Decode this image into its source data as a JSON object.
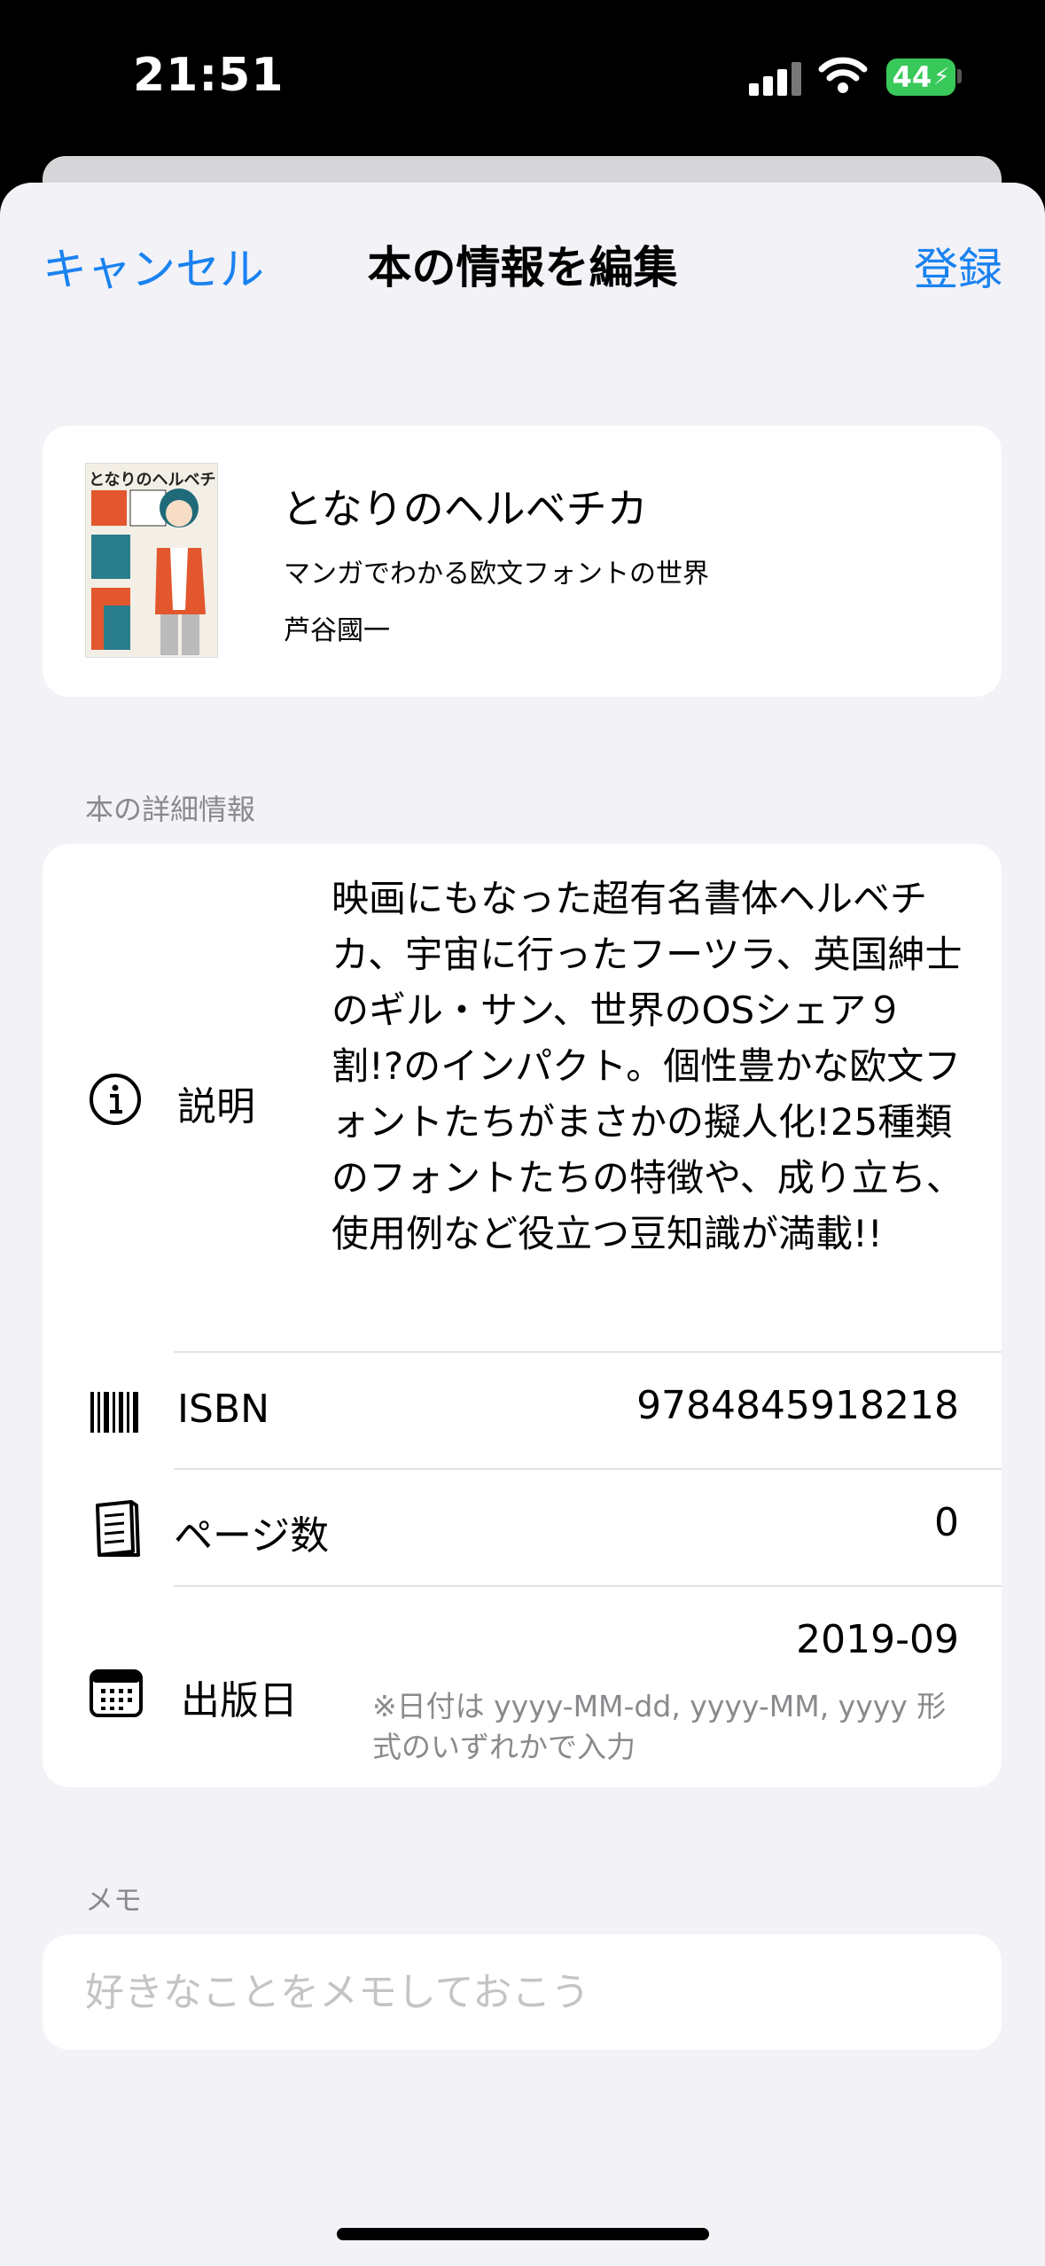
{
  "status_bar": {
    "time": "21:51",
    "battery": "44"
  },
  "nav": {
    "cancel_label": "キャンセル",
    "title": "本の情報を編集",
    "register_label": "登録"
  },
  "book": {
    "cover_text": "となりのヘルベチカ",
    "title": "となりのヘルベチカ",
    "subtitle": "マンガでわかる欧文フォントの世界",
    "author": "芦谷國一"
  },
  "details": {
    "section_title": "本の詳細情報",
    "description": {
      "label": "説明",
      "icon": "info-icon",
      "value": "映画にもなった超有名書体ヘルベチカ、宇宙に行ったフーツラ、英国紳士のギル・サン、世界のOSシェア９割!?のインパクト。個性豊かな欧文フォントたちがまさかの擬人化!25種類のフォントたちの特徴や、成り立ち、使用例など役立つ豆知識が満載!!"
    },
    "isbn": {
      "label": "ISBN",
      "icon": "barcode-icon",
      "value": "9784845918218"
    },
    "pages": {
      "label": "ページ数",
      "icon": "book-pages-icon",
      "value": "0"
    },
    "published": {
      "label": "出版日",
      "icon": "calendar-icon",
      "value": "2019-09",
      "hint": "※日付は yyyy-MM-dd, yyyy-MM, yyyy 形式のいずれかで入力"
    }
  },
  "memo": {
    "section_title": "メモ",
    "placeholder": "好きなことをメモしておこう"
  }
}
